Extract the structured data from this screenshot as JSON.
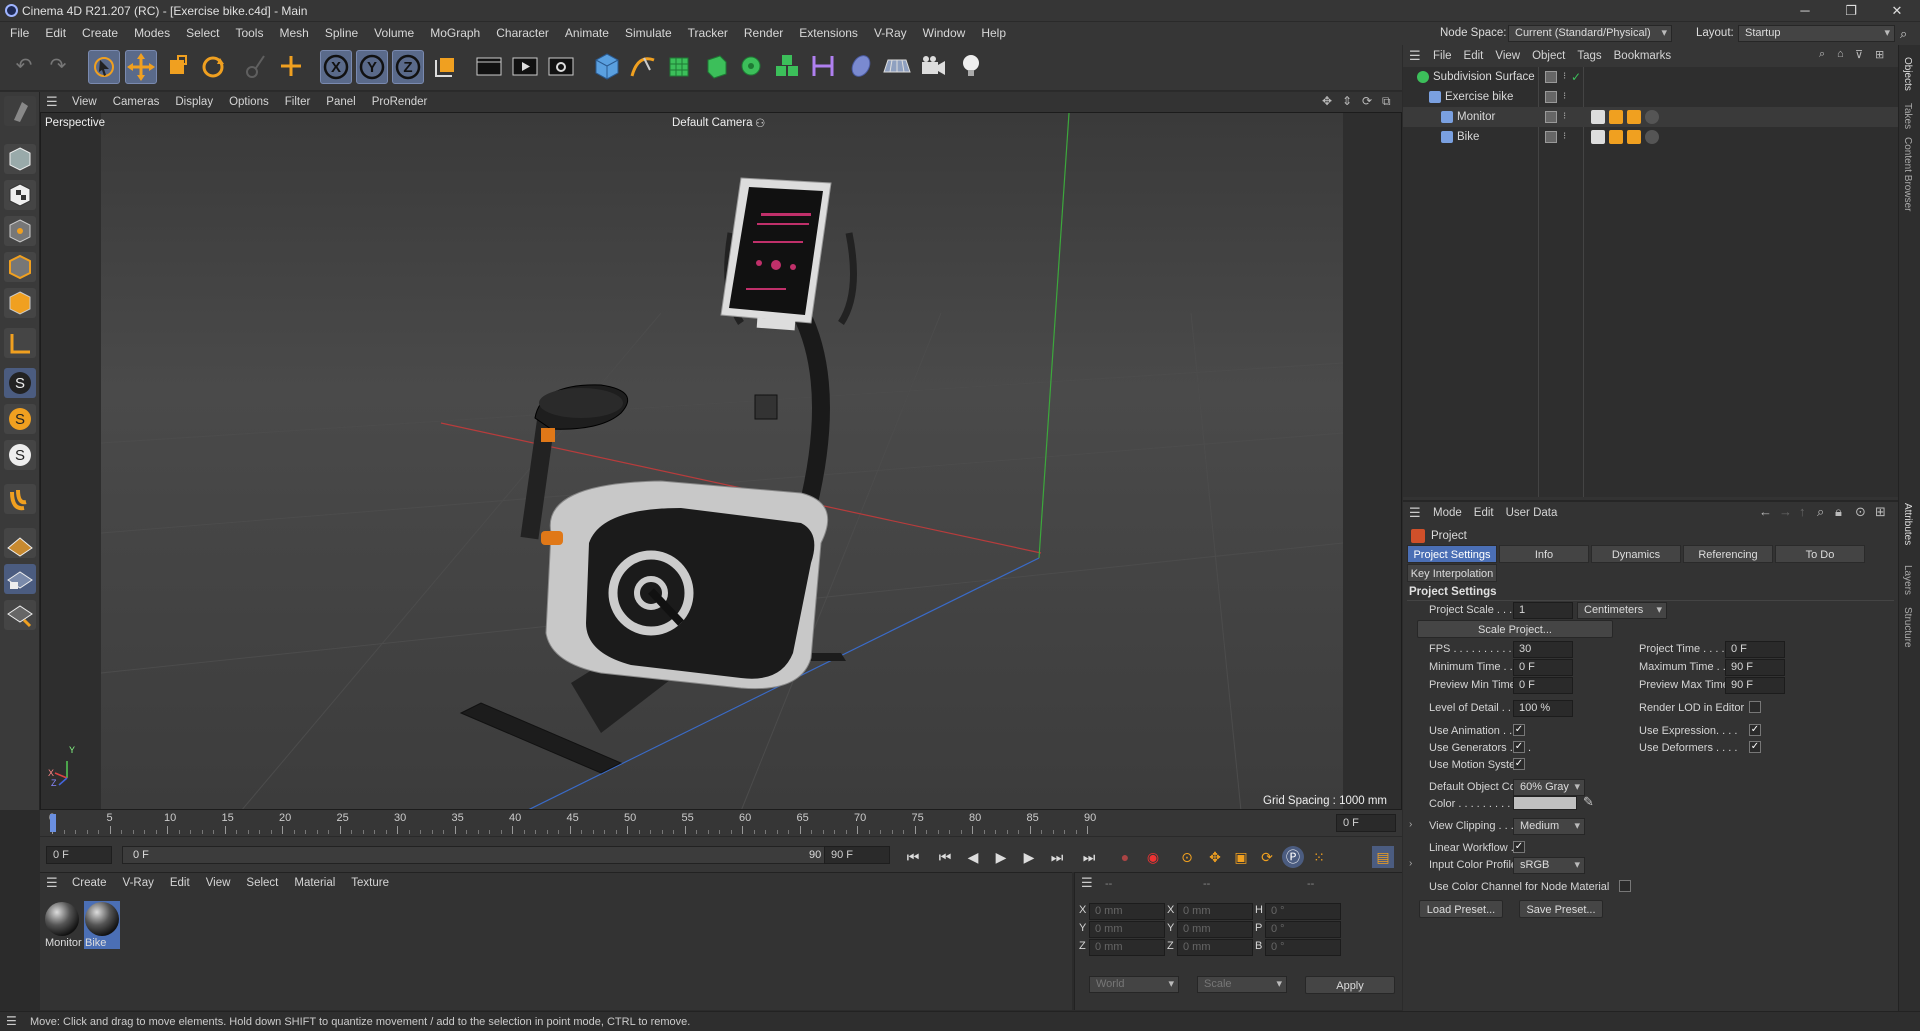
{
  "window": {
    "title": "Cinema 4D R21.207 (RC) - [Exercise bike.c4d] - Main",
    "min": "─",
    "max": "❐",
    "close": "✕",
    "node_space_label": "Node Space:",
    "node_space_value": "Current (Standard/Physical)",
    "layout_label": "Layout:",
    "layout_value": "Startup"
  },
  "menu": [
    "File",
    "Edit",
    "Create",
    "Modes",
    "Select",
    "Tools",
    "Mesh",
    "Spline",
    "Volume",
    "MoGraph",
    "Character",
    "Animate",
    "Simulate",
    "Tracker",
    "Render",
    "Extensions",
    "V-Ray",
    "Window",
    "Help"
  ],
  "toolbar": {
    "x": "X",
    "y": "Y",
    "z": "Z"
  },
  "viewport": {
    "menu": [
      "View",
      "Cameras",
      "Display",
      "Options",
      "Filter",
      "Panel",
      "ProRender"
    ],
    "label": "Perspective",
    "camera": "Default Camera",
    "grid_spacing": "Grid Spacing : 1000 mm",
    "axis_x": "X",
    "axis_y": "Y",
    "axis_z": "Z"
  },
  "timeline": {
    "ticks": [
      "0",
      "5",
      "10",
      "15",
      "20",
      "25",
      "30",
      "35",
      "40",
      "45",
      "50",
      "55",
      "60",
      "65",
      "70",
      "75",
      "80",
      "85",
      "90"
    ],
    "current": "0 F",
    "start": "0 F",
    "range_start": "0 F",
    "range_end": "90 F",
    "end": "90 F"
  },
  "materials": {
    "menu": [
      "Create",
      "V-Ray",
      "Edit",
      "View",
      "Select",
      "Material",
      "Texture"
    ],
    "items": [
      {
        "name": "Monitor",
        "selected": false
      },
      {
        "name": "Bike",
        "selected": true
      }
    ]
  },
  "coords": {
    "dash1": "--",
    "dash2": "--",
    "dash3": "--",
    "rows": [
      {
        "a": "X",
        "av": "0 mm",
        "b": "X",
        "bv": "0 mm",
        "c": "H",
        "cv": "0 °"
      },
      {
        "a": "Y",
        "av": "0 mm",
        "b": "Y",
        "bv": "0 mm",
        "c": "P",
        "cv": "0 °"
      },
      {
        "a": "Z",
        "av": "0 mm",
        "b": "Z",
        "bv": "0 mm",
        "c": "B",
        "cv": "0 °"
      }
    ],
    "world": "World",
    "scale": "Scale",
    "apply": "Apply"
  },
  "status": "Move: Click and drag to move elements. Hold down SHIFT to quantize movement / add to the selection in point mode, CTRL to remove.",
  "objects": {
    "menu": [
      "File",
      "Edit",
      "View",
      "Object",
      "Tags",
      "Bookmarks"
    ],
    "items": [
      {
        "name": "Subdivision Surface"
      },
      {
        "name": "Exercise bike"
      },
      {
        "name": "Monitor"
      },
      {
        "name": "Bike"
      }
    ]
  },
  "attributes": {
    "menu": [
      "Mode",
      "Edit",
      "User Data"
    ],
    "object": "Project",
    "tabs": [
      "Project Settings",
      "Info",
      "Dynamics",
      "Referencing",
      "To Do"
    ],
    "tab2": "Key Interpolation",
    "section": "Project Settings",
    "project_scale_label": "Project Scale . . . . .",
    "project_scale": "1",
    "project_scale_unit": "Centimeters",
    "scale_project": "Scale Project...",
    "fps_label": "FPS . . . . . . . . . . . . .",
    "fps": "30",
    "project_time_label": "Project Time . . . . .",
    "project_time": "0 F",
    "min_time_label": "Minimum Time . . . .",
    "min_time": "0 F",
    "max_time_label": "Maximum Time . . .",
    "max_time": "90 F",
    "prev_min_label": "Preview Min Time . .",
    "prev_min": "0 F",
    "prev_max_label": "Preview Max Time .",
    "prev_max": "90 F",
    "lod_label": "Level of Detail . . . .",
    "lod": "100 %",
    "render_lod_label": "Render LOD in Editor",
    "use_anim_label": "Use Animation . . . .",
    "use_expr_label": "Use Expression. . . .",
    "use_gen_label": "Use Generators . . . .",
    "use_def_label": "Use Deformers . . . .",
    "use_motion_label": "Use Motion System",
    "def_color_label": "Default Object Color",
    "def_color": "60% Gray",
    "color_label": "Color . . . . . . . . . .",
    "view_clip_label": "View Clipping . . . . .",
    "view_clip": "Medium",
    "linear_label": "Linear Workflow . . .",
    "input_profile_label": "Input Color Profile . .",
    "input_profile": "sRGB",
    "use_color_channel_label": "Use Color Channel for Node Material",
    "load_preset": "Load Preset...",
    "save_preset": "Save Preset..."
  },
  "sidetabs": [
    "Objects",
    "Takes",
    "Content Browser",
    "Attributes",
    "Layers",
    "Structure"
  ],
  "colors": {
    "accent": "#4b6fb5",
    "orange": "#f0a020"
  }
}
